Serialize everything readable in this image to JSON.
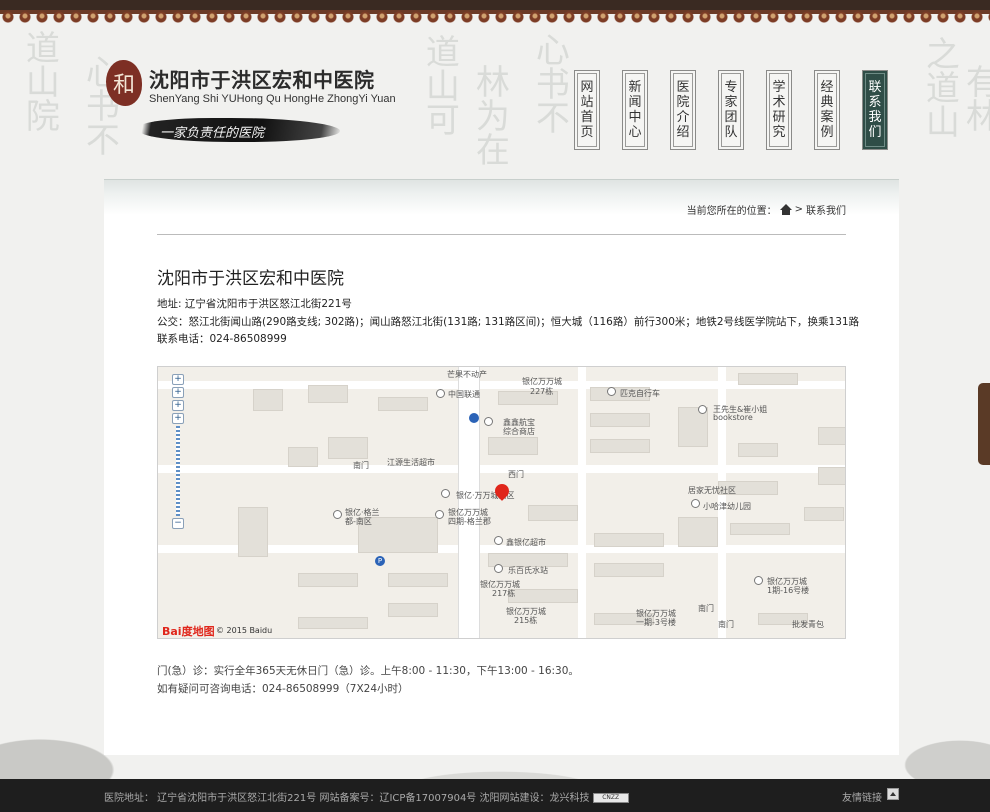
{
  "header": {
    "logo_seal_text": "和",
    "site_title": "沈阳市于洪区宏和中医院",
    "site_subtitle": "ShenYang Shi YUHong Qu HongHe ZhongYi Yuan",
    "slogan": "一家负责任的医院"
  },
  "nav": {
    "items": [
      {
        "label": "网站首页",
        "active": false
      },
      {
        "label": "新闻中心",
        "active": false
      },
      {
        "label": "医院介绍",
        "active": false
      },
      {
        "label": "专家团队",
        "active": false
      },
      {
        "label": "学术研究",
        "active": false
      },
      {
        "label": "经典案例",
        "active": false
      },
      {
        "label": "联系我们",
        "active": true
      }
    ]
  },
  "breadcrumb": {
    "prefix": "当前您所在的位置：",
    "separator": ">",
    "current": "联系我们"
  },
  "contact": {
    "name": "沈阳市于洪区宏和中医院",
    "address": "地址: 辽宁省沈阳市于洪区怒江北街221号",
    "bus": "公交：怒江北街闻山路(290路支线; 302路)；闻山路怒江北街(131路; 131路区间)；恒大城（116路）前行300米；地铁2号线医学院站下，换乘131路",
    "phone": "联系电话：024-86508999"
  },
  "map": {
    "labels": {
      "l1": "芒果不动产",
      "l2": "银亿万万城",
      "l3": "227栋",
      "l4": "匹克自行车",
      "l5": "中国联通",
      "l6": "鑫鑫航宝",
      "l7": "综合商店",
      "l8": "王先生&崔小姐",
      "l9": "bookstore",
      "l10": "江源生活超市",
      "l11": "南门",
      "l12": "西门",
      "l13": "银亿·万万城西区",
      "l14": "居家无忧社区",
      "l15": "小哈津幼儿园",
      "l16": "银亿·格兰",
      "l17": "都-南区",
      "l18": "银亿万万城",
      "l19": "四期-格兰郡",
      "l20": "鑫银亿超市",
      "l21": "乐百氏水站",
      "l22": "银亿万万城",
      "l23": "1期-16号楼",
      "l24": "银亿万万城",
      "l25": "217栋",
      "l26": "南门",
      "l27": "银亿万万城",
      "l28": "215栋",
      "l29": "银亿万万城",
      "l30": "一期-3号楼",
      "l31": "南门",
      "l32": "批发青包"
    },
    "baidu_logo": "Bai度地图",
    "copyright": "© 2015 Baidu"
  },
  "hours": {
    "line1": "门(急）诊：实行全年365天无休日门（急）诊。上午8:00 - 11:30，下午13:00 - 16:30。",
    "line2": "如有疑问可咨询电话：024-86508999（7X24小时）"
  },
  "footer": {
    "text": "医院地址： 辽宁省沈阳市于洪区怒江北街221号  网站备案号：辽ICP备17007904号 沈阳网站建设：龙兴科技",
    "cnzz": "CNZZ",
    "friend_links": "友情链接"
  },
  "colors": {
    "nav_active": "#2f4d47",
    "footer_bg": "#1e1e1e",
    "marker": "#e0261b"
  }
}
